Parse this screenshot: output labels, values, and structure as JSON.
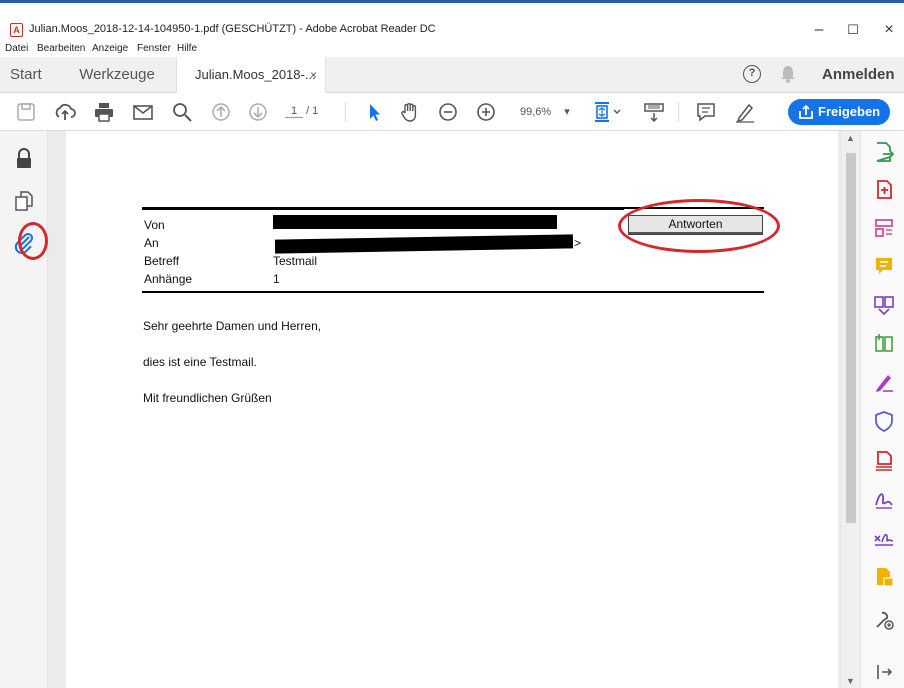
{
  "window": {
    "title": "Julian.Moos_2018-12-14-104950-1.pdf (GESCHÜTZT) - Adobe Acrobat Reader DC",
    "pdf_badge": "A",
    "minimize": "–",
    "maximize": "☐",
    "close": "×"
  },
  "menu": [
    "Datei",
    "Bearbeiten",
    "Anzeige",
    "Fenster",
    "Hilfe"
  ],
  "tabs": {
    "home": "Start",
    "tools": "Werkzeuge",
    "document": "Julian.Moos_2018-...",
    "document_close": "×",
    "help": "?",
    "login": "Anmelden"
  },
  "toolbar": {
    "page_current": "1",
    "page_total": "/ 1",
    "zoom": "99,6%",
    "zoom_caret": "▾",
    "share": "Freigeben"
  },
  "email": {
    "labels": [
      "Von",
      "An",
      "Betreff",
      "Anhänge"
    ],
    "subject": "Testmail",
    "attachments": "1",
    "to_tail": ">",
    "reply_button": "Antworten",
    "body": [
      "Sehr geehrte Damen und Herren,",
      "dies ist eine Testmail.",
      "Mit freundlichen Grüßen"
    ]
  },
  "scroll": {
    "up": "▲",
    "down": "▼"
  },
  "collapse": {
    "left": "◀",
    "right": "◀"
  },
  "colors": {
    "accent": "#1473e6",
    "annotation": "#d7262c",
    "pdf_red": "#c9302c"
  },
  "icons": {
    "left_rail": [
      "lock-icon",
      "copy-pages-icon",
      "attachment-icon"
    ],
    "right_rail": [
      "export-pdf-icon",
      "create-pdf-icon",
      "edit-pdf-icon",
      "comment-icon",
      "combine-files-icon",
      "organize-pages-icon",
      "fill-sign-icon",
      "protect-icon",
      "print-production-icon",
      "send-for-signature-icon",
      "certificates-icon",
      "stamp-icon",
      "more-tools-icon",
      "expand-pane-icon"
    ]
  }
}
